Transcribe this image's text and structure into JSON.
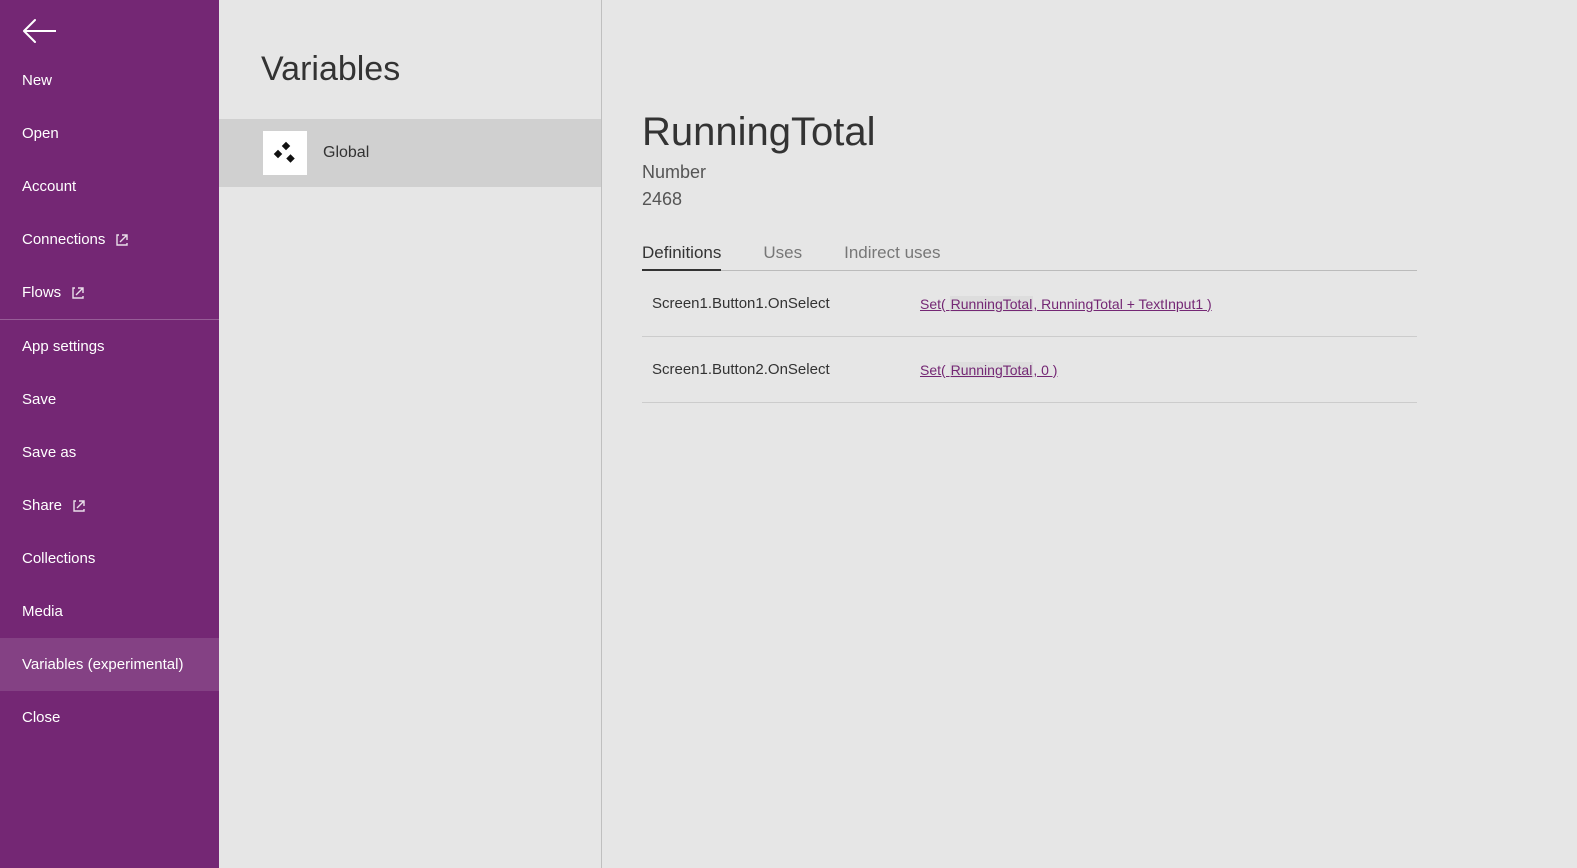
{
  "sidebar": {
    "items": [
      {
        "label": "New",
        "external": false
      },
      {
        "label": "Open",
        "external": false
      },
      {
        "label": "Account",
        "external": false
      },
      {
        "label": "Connections",
        "external": true
      },
      {
        "label": "Flows",
        "external": true
      },
      {
        "label": "App settings",
        "external": false
      },
      {
        "label": "Save",
        "external": false
      },
      {
        "label": "Save as",
        "external": false
      },
      {
        "label": "Share",
        "external": true
      },
      {
        "label": "Collections",
        "external": false
      },
      {
        "label": "Media",
        "external": false
      },
      {
        "label": "Variables (experimental)",
        "external": false,
        "selected": true
      },
      {
        "label": "Close",
        "external": false
      }
    ]
  },
  "col2": {
    "title": "Variables",
    "scopes": [
      {
        "label": "Global",
        "selected": true
      }
    ]
  },
  "detail": {
    "name": "RunningTotal",
    "type": "Number",
    "value": "2468",
    "tabs": [
      {
        "label": "Definitions",
        "active": true
      },
      {
        "label": "Uses",
        "active": false
      },
      {
        "label": "Indirect uses",
        "active": false
      }
    ],
    "definitions": [
      {
        "location": "Screen1.Button1.OnSelect",
        "formula_pre": "Set( ",
        "formula_hl": "RunningTotal",
        "formula_post": ", RunningTotal + TextInput1 )"
      },
      {
        "location": "Screen1.Button2.OnSelect",
        "formula_pre": "Set( ",
        "formula_hl": "RunningTotal",
        "formula_post": ", 0 )"
      }
    ]
  }
}
